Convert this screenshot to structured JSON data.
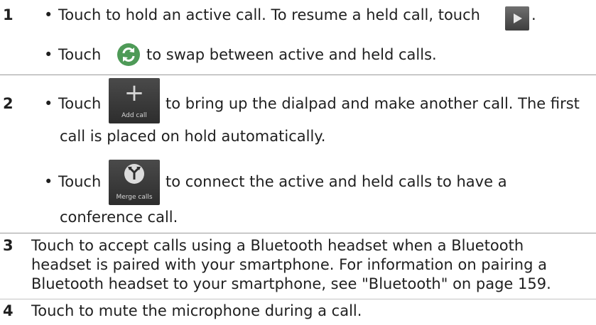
{
  "rows": [
    {
      "number": "1",
      "bullets": [
        {
          "text_before": "Touch to hold an active call. To resume a held call, touch",
          "text_after": ".",
          "icon": "play-icon"
        },
        {
          "text_before": "Touch",
          "text_after": "to swap between active and held calls.",
          "icon": "swap-icon"
        }
      ]
    },
    {
      "number": "2",
      "bullets": [
        {
          "text_before": "Touch",
          "text_after": "to bring up the dialpad and make another call. The first",
          "text_cont": "call is placed on hold automatically.",
          "icon": "plus-icon",
          "icon_caption": "Add call"
        },
        {
          "text_before": "Touch",
          "text_after": "to connect the active and held calls to have a",
          "text_cont": "conference call.",
          "icon": "merge-icon",
          "icon_caption": "Merge calls"
        }
      ]
    },
    {
      "number": "3",
      "lines": [
        "Touch to accept calls using a Bluetooth headset when a Bluetooth",
        "headset is paired with your smartphone. For information on pairing a",
        "Bluetooth headset to your smartphone, see \"Bluetooth\" on page 159."
      ]
    },
    {
      "number": "4",
      "lines": [
        "Touch to mute the microphone during a call."
      ]
    }
  ],
  "bullet_char": "•",
  "colors": {
    "swap_icon": "#4e9a57",
    "rule": "#9a9a9a"
  }
}
